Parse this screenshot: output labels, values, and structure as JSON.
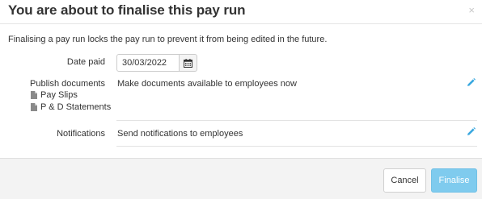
{
  "header": {
    "title": "You are about to finalise this pay run",
    "close_glyph": "×"
  },
  "intro_text": "Finalising a pay run locks the pay run to prevent it from being edited in the future.",
  "date_paid": {
    "label": "Date paid",
    "value": "30/03/2022",
    "icon": "calendar-icon"
  },
  "publish": {
    "label": "Publish documents",
    "documents": [
      "Pay Slips",
      "P & D Statements"
    ],
    "document_icon": "file-icon",
    "value": "Make documents available to employees now",
    "edit_icon": "pencil-icon"
  },
  "notifications": {
    "label": "Notifications",
    "value": "Send notifications to employees",
    "edit_icon": "pencil-icon"
  },
  "footer": {
    "cancel_label": "Cancel",
    "finalise_label": "Finalise"
  },
  "colors": {
    "accent": "#7fcbee",
    "pencil": "#3aa8df"
  }
}
